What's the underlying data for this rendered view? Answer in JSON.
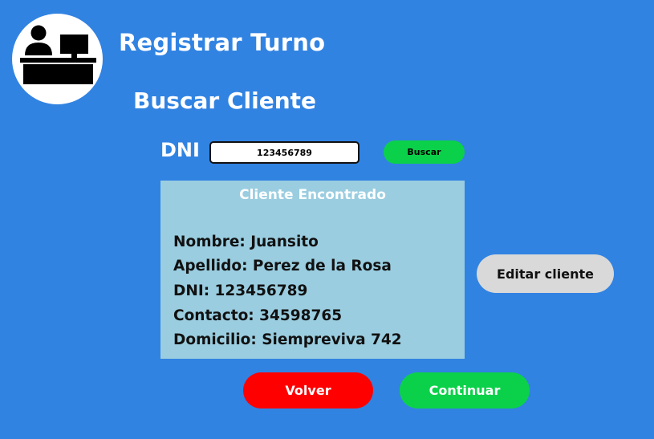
{
  "header": {
    "title": "Registrar Turno",
    "logo_icon": "reception-desk-icon"
  },
  "search": {
    "heading": "Buscar Cliente",
    "dni_label": "DNI",
    "dni_value": "123456789",
    "button_label": "Buscar"
  },
  "client_card": {
    "title": "Cliente Encontrado",
    "fields": [
      "Nombre: Juansito",
      "Apellido: Perez de la Rosa",
      "DNI: 123456789",
      "Contacto: 34598765",
      "Domicilio: Siempreviva 742"
    ]
  },
  "actions": {
    "edit_label": "Editar cliente",
    "back_label": "Volver",
    "continue_label": "Continuar"
  },
  "colors": {
    "background": "#3183e2",
    "card": "#9acde0",
    "green": "#0bd14a",
    "red": "#ff0000",
    "gray": "#d9d9d9"
  }
}
